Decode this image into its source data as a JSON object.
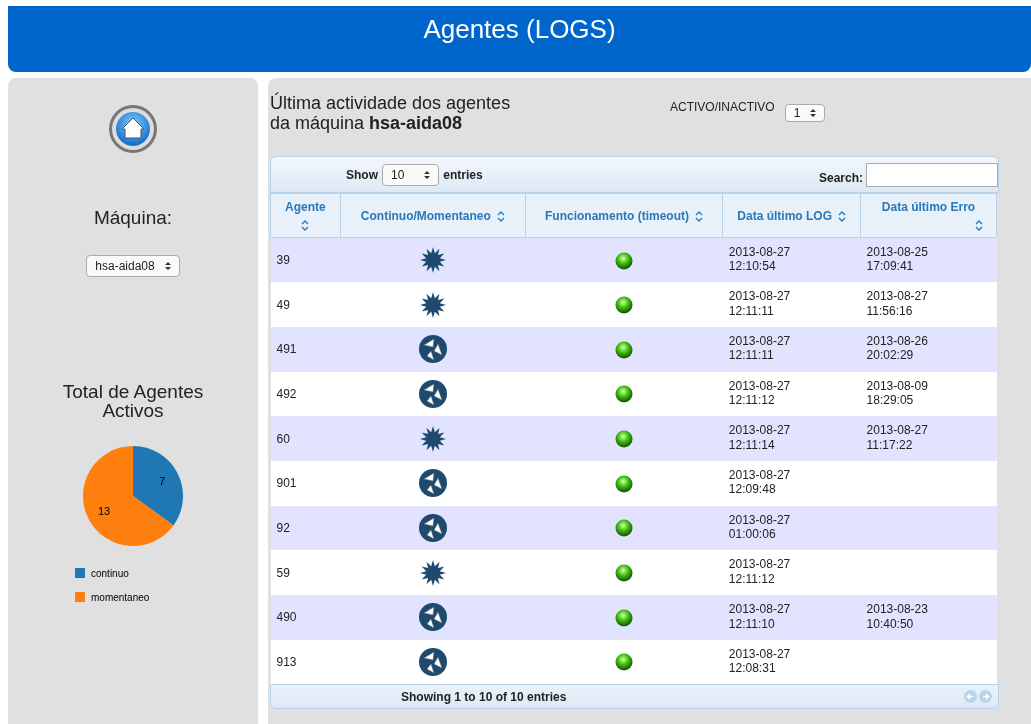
{
  "header": {
    "title": "Agentes (LOGS)"
  },
  "sidebar": {
    "machine_label": "Máquina:",
    "machine_value": "hsa-aida08",
    "chart_title": "Total de Agentes Activos",
    "chart_data": {
      "type": "pie",
      "categories": [
        "continuo",
        "momentaneo"
      ],
      "values": [
        7,
        13
      ],
      "data_labels": true,
      "legend": true
    },
    "slices": [
      {
        "color": "#1f77b4"
      },
      {
        "color": "#ff7f0e"
      }
    ]
  },
  "main": {
    "heading": "Última actividade dos agentes\nda máquina **hsa-aida08**",
    "filter_label": "ACTIVO/INACTIVO",
    "filter_value": "1"
  },
  "table": {
    "show_label": "Show",
    "page_size": "10",
    "entries_label": "entries",
    "search_label": "Search:",
    "columns": [
      "Agente",
      "Continuo/Momentaneo",
      "Funcionamento (timeout)",
      "Data último LOG",
      "Data último Erro"
    ],
    "rows": [
      {
        "agent": "39",
        "kind": "burst",
        "running": true,
        "last_log": "2013-08-27\n12:10:54",
        "last_error": "2013-08-25\n17:09:41"
      },
      {
        "agent": "49",
        "kind": "burst",
        "running": true,
        "last_log": "2013-08-27\n12:11:11",
        "last_error": "2013-08-27\n11:56:16"
      },
      {
        "agent": "491",
        "kind": "cycle",
        "running": true,
        "last_log": "2013-08-27\n12:11:11",
        "last_error": "2013-08-26\n20:02:29"
      },
      {
        "agent": "492",
        "kind": "cycle",
        "running": true,
        "last_log": "2013-08-27\n12:11:12",
        "last_error": "2013-08-09\n18:29:05"
      },
      {
        "agent": "60",
        "kind": "burst",
        "running": true,
        "last_log": "2013-08-27\n12:11:14",
        "last_error": "2013-08-27\n11:17:22"
      },
      {
        "agent": "901",
        "kind": "cycle",
        "running": true,
        "last_log": "2013-08-27\n12:09:48"
      },
      {
        "agent": "92",
        "kind": "cycle",
        "running": true,
        "last_log": "2013-08-27\n01:00:06"
      },
      {
        "agent": "59",
        "kind": "burst",
        "running": true,
        "last_log": "2013-08-27\n12:11:12"
      },
      {
        "agent": "490",
        "kind": "cycle",
        "running": true,
        "last_log": "2013-08-27\n12:11:10",
        "last_error": "2013-08-23\n10:40:50"
      },
      {
        "agent": "913",
        "kind": "cycle",
        "running": true,
        "last_log": "2013-08-27\n12:08:31"
      }
    ],
    "info": "Showing 1 to 10 of 10 entries"
  }
}
